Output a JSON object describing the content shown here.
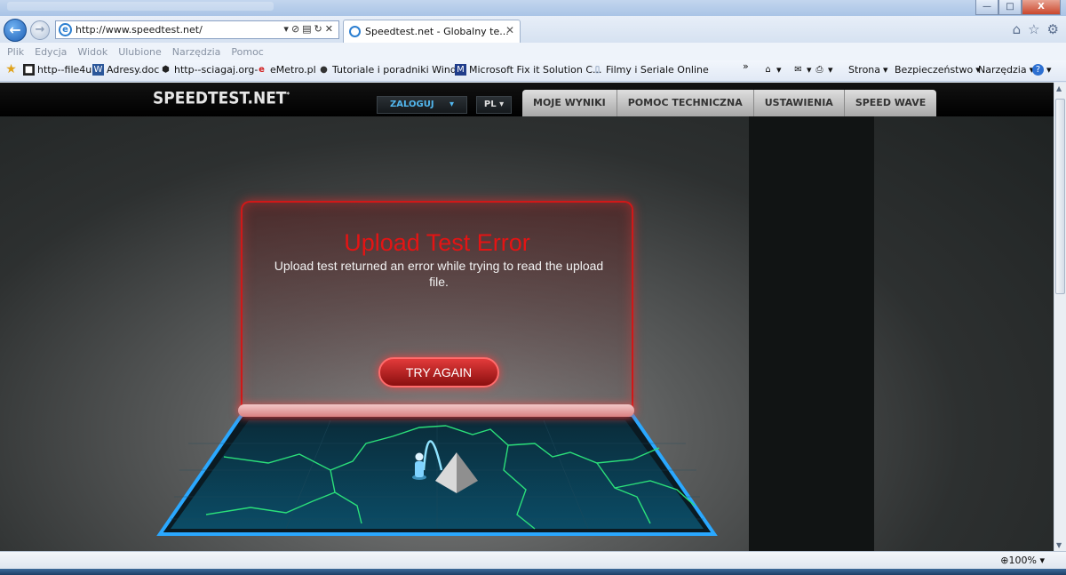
{
  "browser": {
    "url": "http://www.speedtest.net/",
    "tab_title": "Speedtest.net - Globalny te...",
    "window_controls": {
      "minimize": "—",
      "maximize": "□",
      "close": "X"
    },
    "menu": [
      "Plik",
      "Edycja",
      "Widok",
      "Ulubione",
      "Narzędzia",
      "Pomoc"
    ],
    "favorites": [
      {
        "label": "http--file4u",
        "icon": "file4u-icon"
      },
      {
        "label": "Adresy.doc",
        "icon": "word-doc-icon"
      },
      {
        "label": "http--sciagaj.org-",
        "icon": "sciagaj-icon"
      },
      {
        "label": "eMetro.pl",
        "icon": "emetro-icon"
      },
      {
        "label": "Tutoriale i poradniki Wind...",
        "icon": "tutorial-icon"
      },
      {
        "label": "Microsoft Fix it Solution C...",
        "icon": "fixit-icon"
      },
      {
        "label": "Filmy i Seriale Online",
        "icon": "page-icon"
      }
    ],
    "command_bar": {
      "strona": "Strona",
      "bezpieczenstwo": "Bezpieczeństwo",
      "narzedzia": "Narzędzia",
      "more": "»"
    },
    "zoom": "100%"
  },
  "speedtest": {
    "logo": "SPEEDTEST.NET",
    "logo_mark": "*",
    "login": "ZALOGUJ",
    "lang": "PL",
    "nav": [
      "MOJE WYNIKI",
      "POMOC TECHNICZNA",
      "USTAWIENIA",
      "SPEED WAVE"
    ],
    "error_title": "Upload Test Error",
    "error_message": "Upload test returned an error while trying to read the upload file.",
    "try_again": "TRY AGAIN"
  },
  "colors": {
    "error_red": "#e41414",
    "login_blue": "#52b7ee",
    "map_line": "#2be07a",
    "platform_edge": "#2aa8ff"
  }
}
